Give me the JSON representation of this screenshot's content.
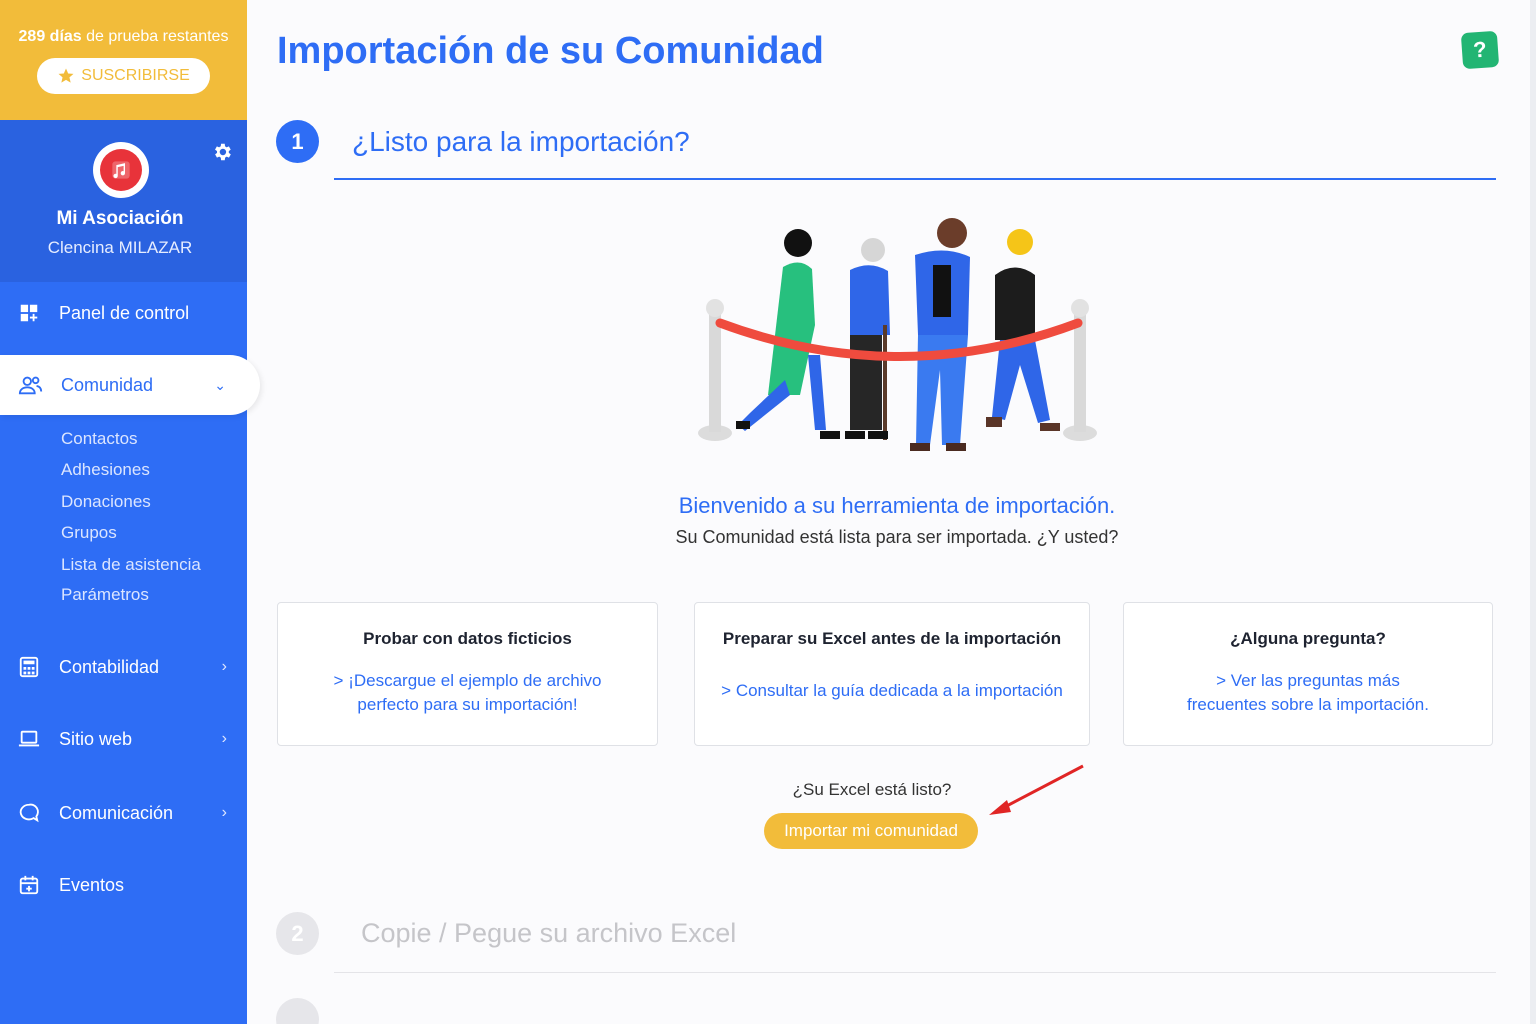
{
  "trial": {
    "days": "289 días",
    "text": " de prueba restantes",
    "subscribe_label": "SUSCRIBIRSE"
  },
  "org": {
    "name": "Mi Asociación",
    "user": "Clencina MILAZAR"
  },
  "nav": {
    "dashboard": "Panel de control",
    "community": "Comunidad",
    "community_sub": [
      "Contactos",
      "Adhesiones",
      "Donaciones",
      "Grupos",
      "Lista de asistencia",
      "Parámetros"
    ],
    "accounting": "Contabilidad",
    "website": "Sitio web",
    "communication": "Comunicación",
    "events": "Eventos"
  },
  "page": {
    "title": "Importación de su Comunidad",
    "help": "?"
  },
  "steps": [
    {
      "number": "1",
      "title": "¿Listo para la importación?"
    },
    {
      "number": "2",
      "title": "Copie / Pegue su archivo Excel"
    }
  ],
  "welcome": {
    "title": "Bienvenido a su herramienta de importación.",
    "subtitle": "Su Comunidad está lista para ser importada. ¿Y usted?"
  },
  "cards": [
    {
      "title": "Probar con datos ficticios",
      "link_line1": "> ¡Descargue el ejemplo de archivo",
      "link_line2": "perfecto para su importación!"
    },
    {
      "title": "Preparar su Excel antes de la importación",
      "link_line1": "> Consultar la guía dedicada a la importación"
    },
    {
      "title": "¿Alguna pregunta?",
      "link_line1": "> Ver las preguntas más",
      "link_line2": "frecuentes sobre la importación."
    }
  ],
  "import": {
    "question": "¿Su Excel está listo?",
    "button": "Importar mi comunidad"
  },
  "colors": {
    "primary": "#2e6df5",
    "accent_yellow": "#f2bc3a",
    "help_green": "#22b573",
    "arrow_red": "#e02525"
  }
}
